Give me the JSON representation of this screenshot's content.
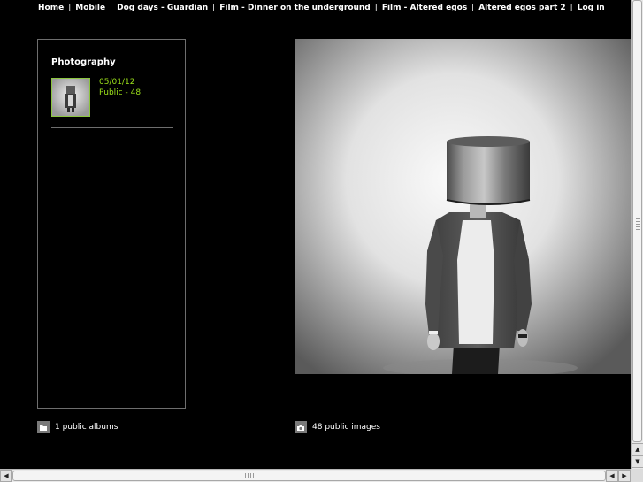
{
  "nav": {
    "items": [
      {
        "label": "Home"
      },
      {
        "label": "Mobile"
      },
      {
        "label": "Dog days - Guardian"
      },
      {
        "label": "Film - Dinner on the underground"
      },
      {
        "label": "Film - Altered egos"
      },
      {
        "label": "Altered egos part 2"
      },
      {
        "label": "Log in"
      }
    ],
    "separator": "|"
  },
  "album": {
    "title": "Photography",
    "date": "05/01/12",
    "visibility": "Public - 48"
  },
  "footer": {
    "albums_count": "1 public albums",
    "images_count": "48 public images"
  },
  "colors": {
    "background": "#000000",
    "accent_green": "#9be01a",
    "panel_border": "#6e6e6e"
  },
  "icons": {
    "albums": "folder-icon",
    "images": "camera-icon"
  }
}
